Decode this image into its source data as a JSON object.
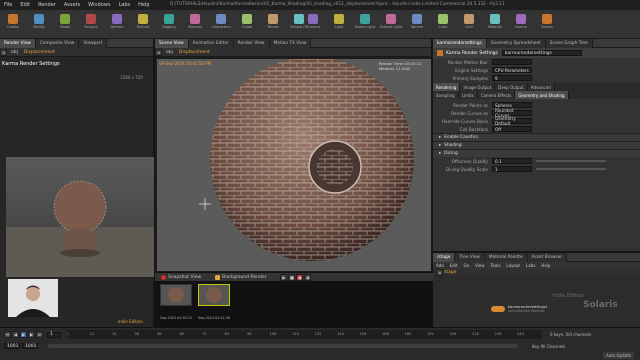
{
  "window": {
    "title": "D:/TUTORIALS/Houdini/Karma/KarmaBasics/05_Karma_Shading/05_shading_v012_displacement.hipnc - Houdini Indie Limited-Commercial 20.5.332 - Py3.11",
    "menu": [
      "File",
      "Edit",
      "Render",
      "Assets",
      "Windows",
      "Labs",
      "Help"
    ],
    "desktop": "Main"
  },
  "shelf": {
    "tools": [
      "Create",
      "Modify",
      "Model",
      "Polygon",
      "Deform",
      "Texture",
      "Rigging",
      "Muscles",
      "Characters",
      "Guide",
      "Terrain",
      "Simple FX",
      "Volume"
    ],
    "lops_tools": [
      "Camera",
      "Light",
      "Dome Light",
      "Distant Light",
      "Sphere",
      "Cube",
      "Grid",
      "Material",
      "Karma",
      "Solaris"
    ]
  },
  "left_pane": {
    "tabs": [
      "Render View",
      "Composite View",
      "Viewport"
    ],
    "path": "obj",
    "node": "Displacement",
    "render_title": "Karma Render Settings",
    "res_readout": "1280 x 720",
    "badge": "Indie Edition"
  },
  "center_pane": {
    "tabs": [
      "Scene View",
      "Animation Editor",
      "Render View",
      "Motion FX View"
    ],
    "path": "obj",
    "node": "Displacement",
    "stamp": "09-Sep-2024 04:42:58 PM",
    "stats": {
      "time_label": "Render Time",
      "time": "00:01:12",
      "mem_label": "Memory",
      "mem": "12.0GB"
    },
    "snapshot_label": "Snapshot View",
    "background_label": "Background Render",
    "snapshots": [
      {
        "label": "Sep-2024 04:30:23"
      },
      {
        "label": "Sep-2024 04:42:58"
      }
    ]
  },
  "right_pane": {
    "tabs": [
      "karmarendersettings",
      "Geometry Spreadsheet",
      "Scene Graph Tree"
    ],
    "node_type": "Karma Render Settings",
    "node_name": "karmarendersettings",
    "params": [
      {
        "label": "Render Motion Blur",
        "value": ""
      },
      {
        "label": "Engine Settings",
        "value": "CPU Parameters"
      },
      {
        "label": "Primary Samples",
        "value": "9"
      }
    ],
    "subtabs": [
      "Rendering",
      "Image Output",
      "Deep Output",
      "Advanced"
    ],
    "subtabs2": [
      "Sampling",
      "Limits",
      "Camera Effects",
      "Geometry and Shading"
    ],
    "geo_params": [
      {
        "label": "Render Points as",
        "value": "Spheres"
      },
      {
        "label": "Render Curves as",
        "value": "Rounded Curves"
      },
      {
        "label": "Override Curves Basis",
        "value": "Geometry Default"
      },
      {
        "label": "Cull Backface",
        "value": "Off"
      }
    ],
    "sections": [
      "Enable Caustics",
      "Shading",
      "Dicing"
    ],
    "dicing_params": [
      {
        "label": "Offscreen Quality",
        "value": "0.1"
      },
      {
        "label": "Dicing Quality Scale",
        "value": "1"
      }
    ],
    "network": {
      "tabs": [
        "/stage",
        "Tree View",
        "Material Palette",
        "Asset Browser"
      ],
      "menu": [
        "Add",
        "Edit",
        "Go",
        "View",
        "Tools",
        "Layout",
        "Labs",
        "Help"
      ],
      "path": "stage",
      "watermark_1": "Indie Edition",
      "watermark_2": "Solaris",
      "node_label": "karmarendersettings1",
      "node_sub": "karmaRenderSettings"
    }
  },
  "timeline": {
    "frame": "1",
    "start": "1001",
    "end": "1001",
    "ticks": [
      "1",
      "12",
      "24",
      "36",
      "48",
      "60",
      "72",
      "84",
      "96",
      "108",
      "120",
      "132",
      "144",
      "156",
      "168",
      "180",
      "192",
      "204",
      "216",
      "228",
      "240"
    ],
    "keys_label": "0 keys, 0/0 channels",
    "keyall_label": "Key All Channels",
    "auto_update": "Auto Update"
  },
  "colors": {
    "accent": "#e8a33a",
    "bg": "#2b2b2b",
    "selected": "#6a8f2a"
  }
}
